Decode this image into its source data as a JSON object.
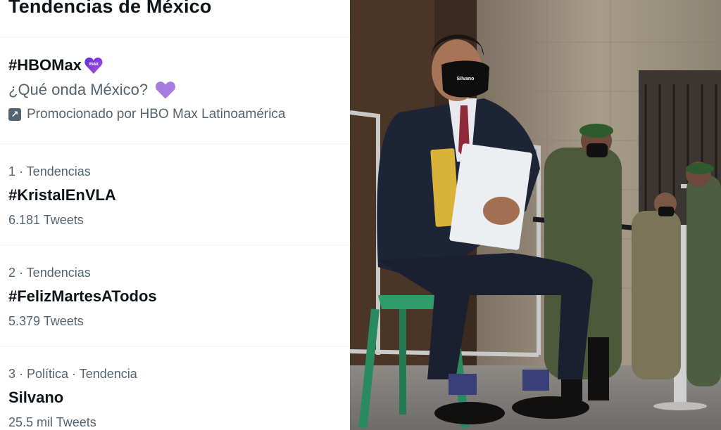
{
  "header": {
    "title": "Tendencias de México"
  },
  "promoted": {
    "hashtag": "#HBOMax",
    "badge_text": "max",
    "subtitle": "¿Qué onda México?",
    "promoted_by": "Promocionado por HBO Max Latinoamérica"
  },
  "trends": [
    {
      "meta": "1 · Tendencias",
      "topic": "#KristalEnVLA",
      "count": "6.181 Tweets"
    },
    {
      "meta": "2 · Tendencias",
      "topic": "#FelizMartesATodos",
      "count": "5.379 Tweets"
    },
    {
      "meta": "3 · Política · Tendencia",
      "topic": "Silvano",
      "count": "25.5 mil Tweets"
    }
  ],
  "photo": {
    "mask_text": "Silvano"
  },
  "colors": {
    "text_primary": "#0f1419",
    "text_secondary": "#536471",
    "purple_heart": "#a77ce0"
  }
}
